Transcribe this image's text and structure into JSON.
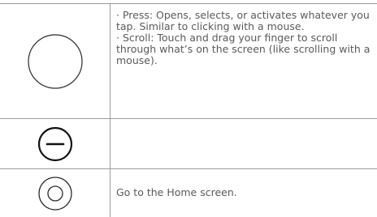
{
  "rows": [
    {
      "icon": "tap-gesture-icon",
      "lines": [
        "· Press: Opens, selects, or activates whatever you tap. Similar to clicking with a mouse.",
        "· Scroll: Touch and drag your finger to scroll through what’s on the screen (like scrolling with a mouse)."
      ]
    },
    {
      "icon": "minus-circle-icon",
      "lines": []
    },
    {
      "icon": "home-button-icon",
      "lines": [
        "Go to the Home screen."
      ]
    }
  ]
}
